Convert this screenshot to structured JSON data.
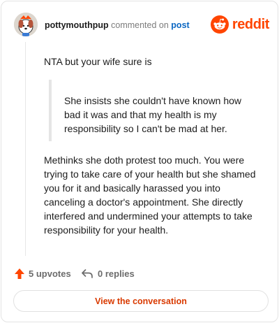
{
  "header": {
    "username": "pottymouthpup",
    "action_text": "commented on",
    "post_link": "post",
    "brand_name": "reddit",
    "brand_color": "#ff4500"
  },
  "comment": {
    "paragraph_1": "NTA but your wife sure is",
    "quote": "She insists she couldn't have known how bad it was and that my health is my responsibility so I can't be mad at her.",
    "paragraph_2": "Methinks she doth protest too much. You were trying to take care of your health but she shamed you for it and basically harassed you into canceling a doctor's appointment. She directly interfered and undermined your attempts to take responsibility for your health."
  },
  "footer": {
    "upvotes_label": "5 upvotes",
    "upvote_icon": "upvote-arrow-icon",
    "replies_label": "0 replies",
    "reply_icon": "reply-arrow-icon",
    "accent_color": "#ff4500"
  },
  "cta": {
    "label": "View the conversation",
    "color": "#d93a00"
  }
}
